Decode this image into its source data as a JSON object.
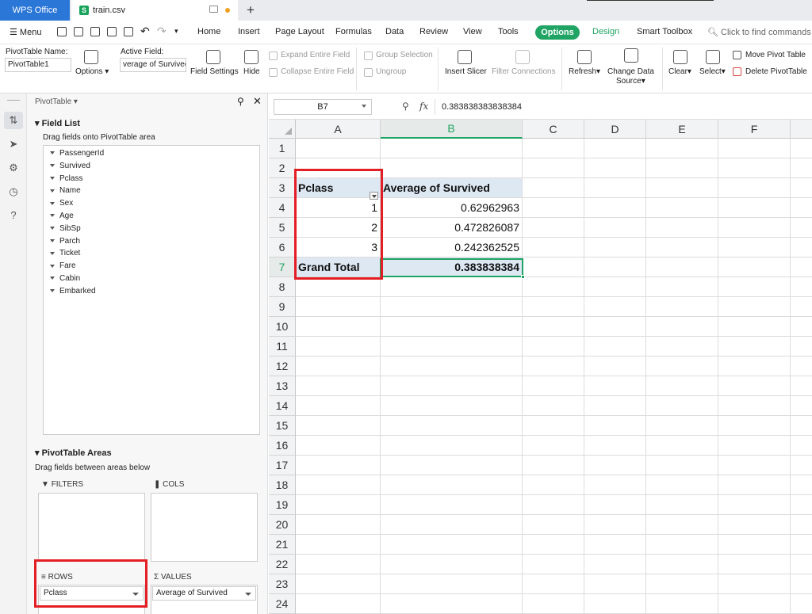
{
  "tabs": {
    "app": "WPS Office",
    "file": "train.csv",
    "file_icon": "S"
  },
  "menu": {
    "menu_label": "Menu",
    "items": [
      "Home",
      "Insert",
      "Page Layout",
      "Formulas",
      "Data",
      "Review",
      "View",
      "Tools"
    ],
    "options": "Options",
    "design": "Design",
    "smart_toolbox": "Smart Toolbox",
    "search_placeholder": "Click to find commands"
  },
  "ribbon": {
    "pt_name_label": "PivotTable Name:",
    "pt_name_value": "PivotTable1",
    "options": "Options",
    "active_field_label": "Active Field:",
    "active_field_value": "verage of Survived",
    "field_settings": "Field Settings",
    "hide": "Hide",
    "expand": "Expand Entire Field",
    "collapse": "Collapse Entire Field",
    "group_selection": "Group Selection",
    "ungroup": "Ungroup",
    "insert_slicer": "Insert Slicer",
    "filter_connections": "Filter Connections",
    "refresh": "Refresh",
    "change_source_1": "Change Data",
    "change_source_2": "Source",
    "clear": "Clear",
    "select": "Select",
    "move_pivot": "Move Pivot Table",
    "delete_pivot": "Delete PivotTable"
  },
  "panel": {
    "title": "PivotTable",
    "field_list": "Field List",
    "drag_fields": "Drag fields onto PivotTable area",
    "fields": [
      "PassengerId",
      "Survived",
      "Pclass",
      "Name",
      "Sex",
      "Age",
      "SibSp",
      "Parch",
      "Ticket",
      "Fare",
      "Cabin",
      "Embarked"
    ],
    "areas_title": "PivotTable Areas",
    "drag_between": "Drag fields between areas below",
    "filters": "FILTERS",
    "cols": "COLS",
    "rows": "ROWS",
    "values": "VALUES",
    "rows_field": "Pclass",
    "values_field": "Average of Survived"
  },
  "formula": {
    "cell_ref": "B7",
    "fx": "fx",
    "value": "0.383838383838384"
  },
  "sheet": {
    "columns": [
      "A",
      "B",
      "C",
      "D",
      "E",
      "F"
    ],
    "rows": [
      "1",
      "2",
      "3",
      "4",
      "5",
      "6",
      "7",
      "8",
      "9",
      "10",
      "11",
      "12",
      "13",
      "14",
      "15",
      "16",
      "17",
      "18",
      "19",
      "20",
      "21",
      "22",
      "23",
      "24"
    ],
    "pivot": {
      "header_a": "Pclass",
      "header_b": "Average of Survived",
      "rows": [
        {
          "a": "1",
          "b": "0.62962963"
        },
        {
          "a": "2",
          "b": "0.472826087"
        },
        {
          "a": "3",
          "b": "0.242362525"
        }
      ],
      "total_a": "Grand Total",
      "total_b": "0.383838384"
    }
  },
  "colors": {
    "accent": "#1fa463",
    "highlight": "#e31e24",
    "brand": "#2b77d8"
  }
}
